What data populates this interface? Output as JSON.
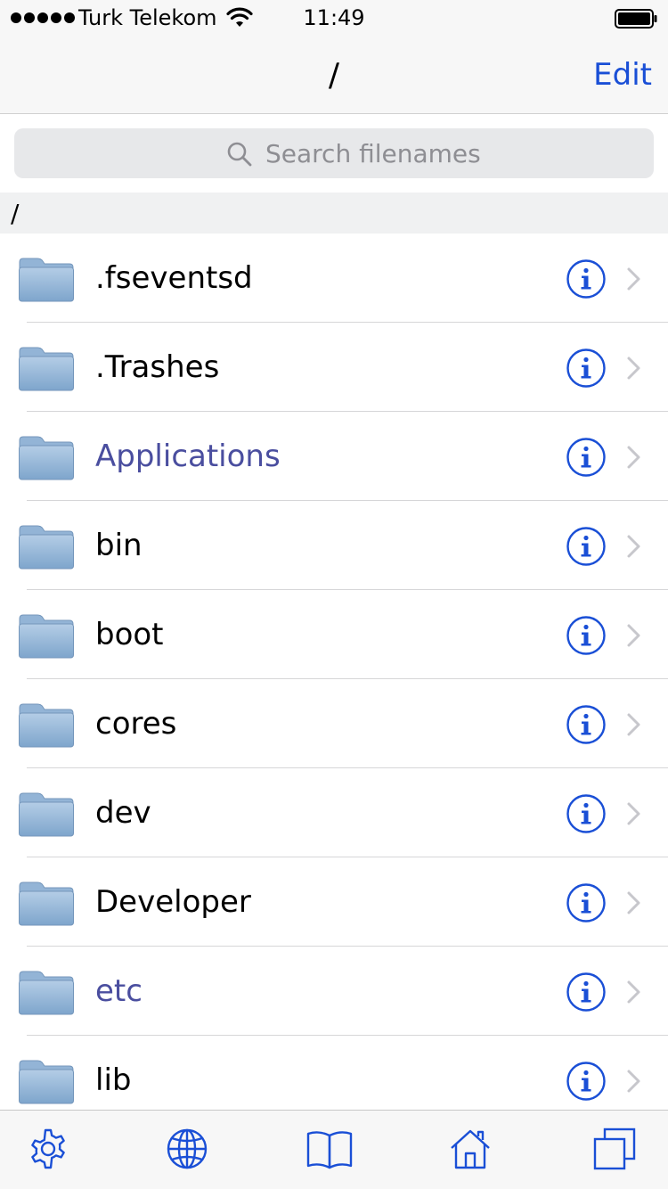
{
  "status_bar": {
    "carrier": "Turk Telekom",
    "time": "11:49",
    "icons": [
      "signal-dots",
      "wifi-icon",
      "battery-icon"
    ]
  },
  "nav": {
    "title": "/",
    "edit_label": "Edit"
  },
  "search": {
    "placeholder": "Search filenames",
    "value": ""
  },
  "path_header": "/",
  "files": [
    {
      "name": ".fseventsd"
    },
    {
      "name": ".Trashes"
    },
    {
      "name": "Applications"
    },
    {
      "name": "bin"
    },
    {
      "name": "boot"
    },
    {
      "name": "cores"
    },
    {
      "name": "dev"
    },
    {
      "name": "Developer"
    },
    {
      "name": "etc"
    },
    {
      "name": "lib"
    }
  ],
  "tab_bar": {
    "tabs": [
      "gear-icon",
      "globe-icon",
      "book-icon",
      "home-icon",
      "windows-icon"
    ]
  },
  "colors": {
    "accent": "#1a4fd6",
    "link_text": "#4a4e9f",
    "folder": "#8eb3d6",
    "chevron": "#c7c7cc"
  }
}
